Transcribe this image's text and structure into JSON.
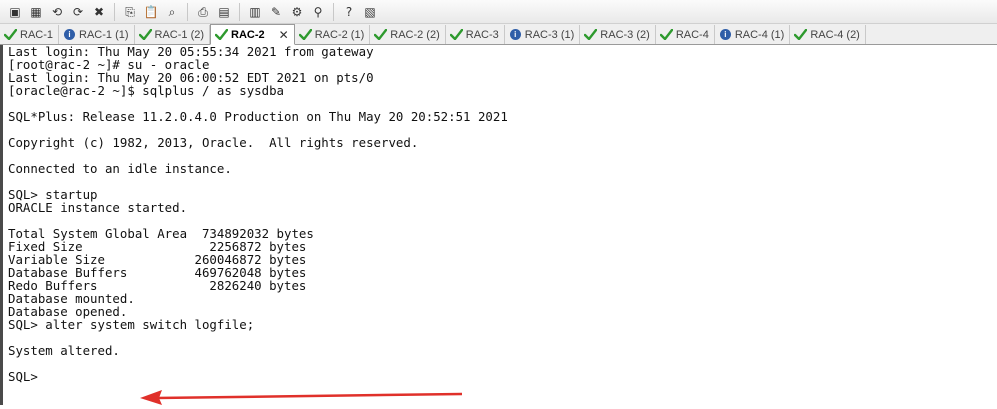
{
  "toolbar": {
    "buttons": [
      {
        "name": "new-session-icon",
        "glyph": "▣"
      },
      {
        "name": "open-session-icon",
        "glyph": "▦"
      },
      {
        "name": "reconnect-icon",
        "glyph": "⟲"
      },
      {
        "name": "reconnect-all-icon",
        "glyph": "⟳"
      },
      {
        "name": "disconnect-icon",
        "glyph": "✖"
      },
      {
        "name": "copy-icon",
        "glyph": "⎘"
      },
      {
        "name": "paste-icon",
        "glyph": "📋"
      },
      {
        "name": "find-icon",
        "glyph": "⌕"
      },
      {
        "name": "print-icon",
        "glyph": "⎙"
      },
      {
        "name": "print-setup-icon",
        "glyph": "▤"
      },
      {
        "name": "log-icon",
        "glyph": "▥"
      },
      {
        "name": "session-options-icon",
        "glyph": "✎"
      },
      {
        "name": "global-options-icon",
        "glyph": "⚙"
      },
      {
        "name": "keymap-icon",
        "glyph": "⚲"
      },
      {
        "name": "help-icon",
        "glyph": "?"
      },
      {
        "name": "screen-icon",
        "glyph": "▧"
      }
    ]
  },
  "tabs": [
    {
      "label": "RAC-1",
      "status": "ok",
      "active": false
    },
    {
      "label": "RAC-1 (1)",
      "status": "info",
      "active": false
    },
    {
      "label": "RAC-1 (2)",
      "status": "ok",
      "active": false
    },
    {
      "label": "RAC-2",
      "status": "ok",
      "active": true
    },
    {
      "label": "RAC-2 (1)",
      "status": "ok",
      "active": false
    },
    {
      "label": "RAC-2 (2)",
      "status": "ok",
      "active": false
    },
    {
      "label": "RAC-3",
      "status": "ok",
      "active": false
    },
    {
      "label": "RAC-3 (1)",
      "status": "info",
      "active": false
    },
    {
      "label": "RAC-3 (2)",
      "status": "ok",
      "active": false
    },
    {
      "label": "RAC-4",
      "status": "ok",
      "active": false
    },
    {
      "label": "RAC-4 (1)",
      "status": "info",
      "active": false
    },
    {
      "label": "RAC-4 (2)",
      "status": "ok",
      "active": false
    }
  ],
  "colors": {
    "ok": "#2e9a2e",
    "info": "#2f5ea8",
    "arrow": "#e0302a"
  },
  "terminal": {
    "lines": [
      "Last login: Thu May 20 05:55:34 2021 from gateway",
      "[root@rac-2 ~]# su - oracle",
      "Last login: Thu May 20 06:00:52 EDT 2021 on pts/0",
      "[oracle@rac-2 ~]$ sqlplus / as sysdba",
      "",
      "SQL*Plus: Release 11.2.0.4.0 Production on Thu May 20 20:52:51 2021",
      "",
      "Copyright (c) 1982, 2013, Oracle.  All rights reserved.",
      "",
      "Connected to an idle instance.",
      "",
      "SQL> startup",
      "ORACLE instance started.",
      "",
      "Total System Global Area  734892032 bytes",
      "Fixed Size                 2256872 bytes",
      "Variable Size            260046872 bytes",
      "Database Buffers         469762048 bytes",
      "Redo Buffers               2826240 bytes",
      "Database mounted.",
      "Database opened.",
      "SQL> alter system switch logfile;",
      "",
      "System altered.",
      "",
      "SQL>"
    ]
  }
}
